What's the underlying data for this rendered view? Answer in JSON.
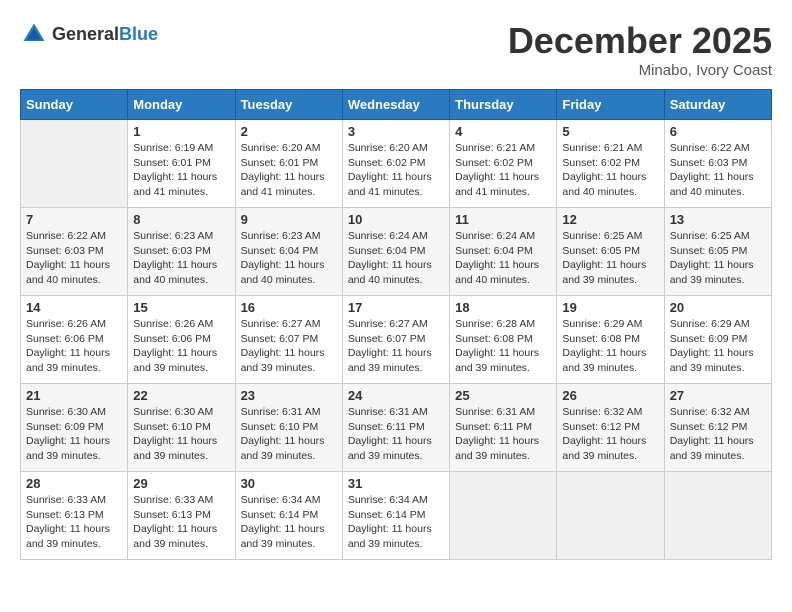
{
  "header": {
    "logo_general": "General",
    "logo_blue": "Blue",
    "title": "December 2025",
    "location": "Minabo, Ivory Coast"
  },
  "days_of_week": [
    "Sunday",
    "Monday",
    "Tuesday",
    "Wednesday",
    "Thursday",
    "Friday",
    "Saturday"
  ],
  "weeks": [
    [
      {
        "day": "",
        "sunrise": "",
        "sunset": "",
        "daylight": ""
      },
      {
        "day": "1",
        "sunrise": "Sunrise: 6:19 AM",
        "sunset": "Sunset: 6:01 PM",
        "daylight": "Daylight: 11 hours and 41 minutes."
      },
      {
        "day": "2",
        "sunrise": "Sunrise: 6:20 AM",
        "sunset": "Sunset: 6:01 PM",
        "daylight": "Daylight: 11 hours and 41 minutes."
      },
      {
        "day": "3",
        "sunrise": "Sunrise: 6:20 AM",
        "sunset": "Sunset: 6:02 PM",
        "daylight": "Daylight: 11 hours and 41 minutes."
      },
      {
        "day": "4",
        "sunrise": "Sunrise: 6:21 AM",
        "sunset": "Sunset: 6:02 PM",
        "daylight": "Daylight: 11 hours and 41 minutes."
      },
      {
        "day": "5",
        "sunrise": "Sunrise: 6:21 AM",
        "sunset": "Sunset: 6:02 PM",
        "daylight": "Daylight: 11 hours and 40 minutes."
      },
      {
        "day": "6",
        "sunrise": "Sunrise: 6:22 AM",
        "sunset": "Sunset: 6:03 PM",
        "daylight": "Daylight: 11 hours and 40 minutes."
      }
    ],
    [
      {
        "day": "7",
        "sunrise": "Sunrise: 6:22 AM",
        "sunset": "Sunset: 6:03 PM",
        "daylight": "Daylight: 11 hours and 40 minutes."
      },
      {
        "day": "8",
        "sunrise": "Sunrise: 6:23 AM",
        "sunset": "Sunset: 6:03 PM",
        "daylight": "Daylight: 11 hours and 40 minutes."
      },
      {
        "day": "9",
        "sunrise": "Sunrise: 6:23 AM",
        "sunset": "Sunset: 6:04 PM",
        "daylight": "Daylight: 11 hours and 40 minutes."
      },
      {
        "day": "10",
        "sunrise": "Sunrise: 6:24 AM",
        "sunset": "Sunset: 6:04 PM",
        "daylight": "Daylight: 11 hours and 40 minutes."
      },
      {
        "day": "11",
        "sunrise": "Sunrise: 6:24 AM",
        "sunset": "Sunset: 6:04 PM",
        "daylight": "Daylight: 11 hours and 40 minutes."
      },
      {
        "day": "12",
        "sunrise": "Sunrise: 6:25 AM",
        "sunset": "Sunset: 6:05 PM",
        "daylight": "Daylight: 11 hours and 39 minutes."
      },
      {
        "day": "13",
        "sunrise": "Sunrise: 6:25 AM",
        "sunset": "Sunset: 6:05 PM",
        "daylight": "Daylight: 11 hours and 39 minutes."
      }
    ],
    [
      {
        "day": "14",
        "sunrise": "Sunrise: 6:26 AM",
        "sunset": "Sunset: 6:06 PM",
        "daylight": "Daylight: 11 hours and 39 minutes."
      },
      {
        "day": "15",
        "sunrise": "Sunrise: 6:26 AM",
        "sunset": "Sunset: 6:06 PM",
        "daylight": "Daylight: 11 hours and 39 minutes."
      },
      {
        "day": "16",
        "sunrise": "Sunrise: 6:27 AM",
        "sunset": "Sunset: 6:07 PM",
        "daylight": "Daylight: 11 hours and 39 minutes."
      },
      {
        "day": "17",
        "sunrise": "Sunrise: 6:27 AM",
        "sunset": "Sunset: 6:07 PM",
        "daylight": "Daylight: 11 hours and 39 minutes."
      },
      {
        "day": "18",
        "sunrise": "Sunrise: 6:28 AM",
        "sunset": "Sunset: 6:08 PM",
        "daylight": "Daylight: 11 hours and 39 minutes."
      },
      {
        "day": "19",
        "sunrise": "Sunrise: 6:29 AM",
        "sunset": "Sunset: 6:08 PM",
        "daylight": "Daylight: 11 hours and 39 minutes."
      },
      {
        "day": "20",
        "sunrise": "Sunrise: 6:29 AM",
        "sunset": "Sunset: 6:09 PM",
        "daylight": "Daylight: 11 hours and 39 minutes."
      }
    ],
    [
      {
        "day": "21",
        "sunrise": "Sunrise: 6:30 AM",
        "sunset": "Sunset: 6:09 PM",
        "daylight": "Daylight: 11 hours and 39 minutes."
      },
      {
        "day": "22",
        "sunrise": "Sunrise: 6:30 AM",
        "sunset": "Sunset: 6:10 PM",
        "daylight": "Daylight: 11 hours and 39 minutes."
      },
      {
        "day": "23",
        "sunrise": "Sunrise: 6:31 AM",
        "sunset": "Sunset: 6:10 PM",
        "daylight": "Daylight: 11 hours and 39 minutes."
      },
      {
        "day": "24",
        "sunrise": "Sunrise: 6:31 AM",
        "sunset": "Sunset: 6:11 PM",
        "daylight": "Daylight: 11 hours and 39 minutes."
      },
      {
        "day": "25",
        "sunrise": "Sunrise: 6:31 AM",
        "sunset": "Sunset: 6:11 PM",
        "daylight": "Daylight: 11 hours and 39 minutes."
      },
      {
        "day": "26",
        "sunrise": "Sunrise: 6:32 AM",
        "sunset": "Sunset: 6:12 PM",
        "daylight": "Daylight: 11 hours and 39 minutes."
      },
      {
        "day": "27",
        "sunrise": "Sunrise: 6:32 AM",
        "sunset": "Sunset: 6:12 PM",
        "daylight": "Daylight: 11 hours and 39 minutes."
      }
    ],
    [
      {
        "day": "28",
        "sunrise": "Sunrise: 6:33 AM",
        "sunset": "Sunset: 6:13 PM",
        "daylight": "Daylight: 11 hours and 39 minutes."
      },
      {
        "day": "29",
        "sunrise": "Sunrise: 6:33 AM",
        "sunset": "Sunset: 6:13 PM",
        "daylight": "Daylight: 11 hours and 39 minutes."
      },
      {
        "day": "30",
        "sunrise": "Sunrise: 6:34 AM",
        "sunset": "Sunset: 6:14 PM",
        "daylight": "Daylight: 11 hours and 39 minutes."
      },
      {
        "day": "31",
        "sunrise": "Sunrise: 6:34 AM",
        "sunset": "Sunset: 6:14 PM",
        "daylight": "Daylight: 11 hours and 39 minutes."
      },
      {
        "day": "",
        "sunrise": "",
        "sunset": "",
        "daylight": ""
      },
      {
        "day": "",
        "sunrise": "",
        "sunset": "",
        "daylight": ""
      },
      {
        "day": "",
        "sunrise": "",
        "sunset": "",
        "daylight": ""
      }
    ]
  ]
}
